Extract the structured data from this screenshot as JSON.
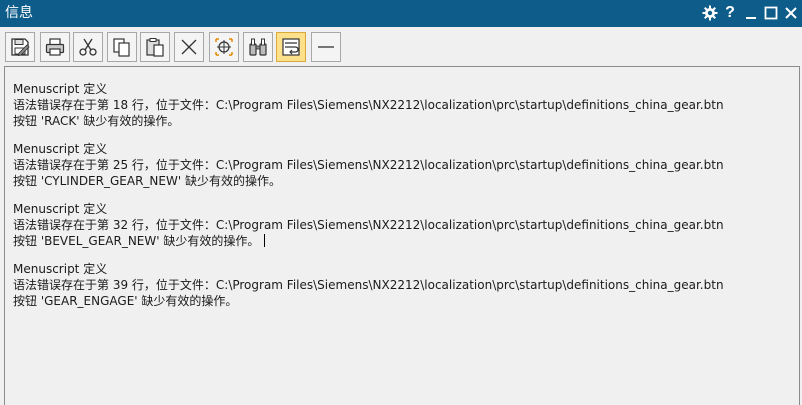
{
  "window": {
    "title": "信息",
    "controls": [
      "gear-icon",
      "help-icon",
      "minimize-icon",
      "maximize-icon",
      "close-icon"
    ],
    "help_label": "?"
  },
  "toolbar": {
    "buttons": [
      {
        "name": "save-icon",
        "active": false
      },
      {
        "name": "print-icon",
        "active": false
      },
      {
        "name": "cut-icon",
        "active": false
      },
      {
        "name": "copy-icon",
        "active": false
      },
      {
        "name": "paste-icon",
        "active": false
      },
      {
        "name": "clear-icon",
        "active": false
      },
      {
        "name": "crosshair-icon",
        "active": false
      },
      {
        "name": "find-binoculars-icon",
        "active": false
      },
      {
        "name": "word-wrap-icon",
        "active": true
      },
      {
        "name": "separator-line-icon",
        "active": false
      }
    ]
  },
  "messages": [
    {
      "header": "Menuscript 定义",
      "error": "语法错误存在于第 18 行，位于文件：C:\\Program Files\\Siemens\\NX2212\\localization\\prc\\startup\\definitions_china_gear.btn",
      "detail": "按钮 'RACK' 缺少有效的操作。"
    },
    {
      "header": "Menuscript 定义",
      "error": "语法错误存在于第 25 行，位于文件：C:\\Program Files\\Siemens\\NX2212\\localization\\prc\\startup\\definitions_china_gear.btn",
      "detail": "按钮 'CYLINDER_GEAR_NEW' 缺少有效的操作。"
    },
    {
      "header": "Menuscript 定义",
      "error": "语法错误存在于第 32 行，位于文件：C:\\Program Files\\Siemens\\NX2212\\localization\\prc\\startup\\definitions_china_gear.btn",
      "detail": "按钮 'BEVEL_GEAR_NEW' 缺少有效的操作。"
    },
    {
      "header": "Menuscript 定义",
      "error": "语法错误存在于第 39 行，位于文件：C:\\Program Files\\Siemens\\NX2212\\localization\\prc\\startup\\definitions_china_gear.btn",
      "detail": "按钮 'GEAR_ENGAGE' 缺少有效的操作。"
    }
  ],
  "colors": {
    "titlebar": "#0d5c8a",
    "active_button": "#fde08a"
  }
}
